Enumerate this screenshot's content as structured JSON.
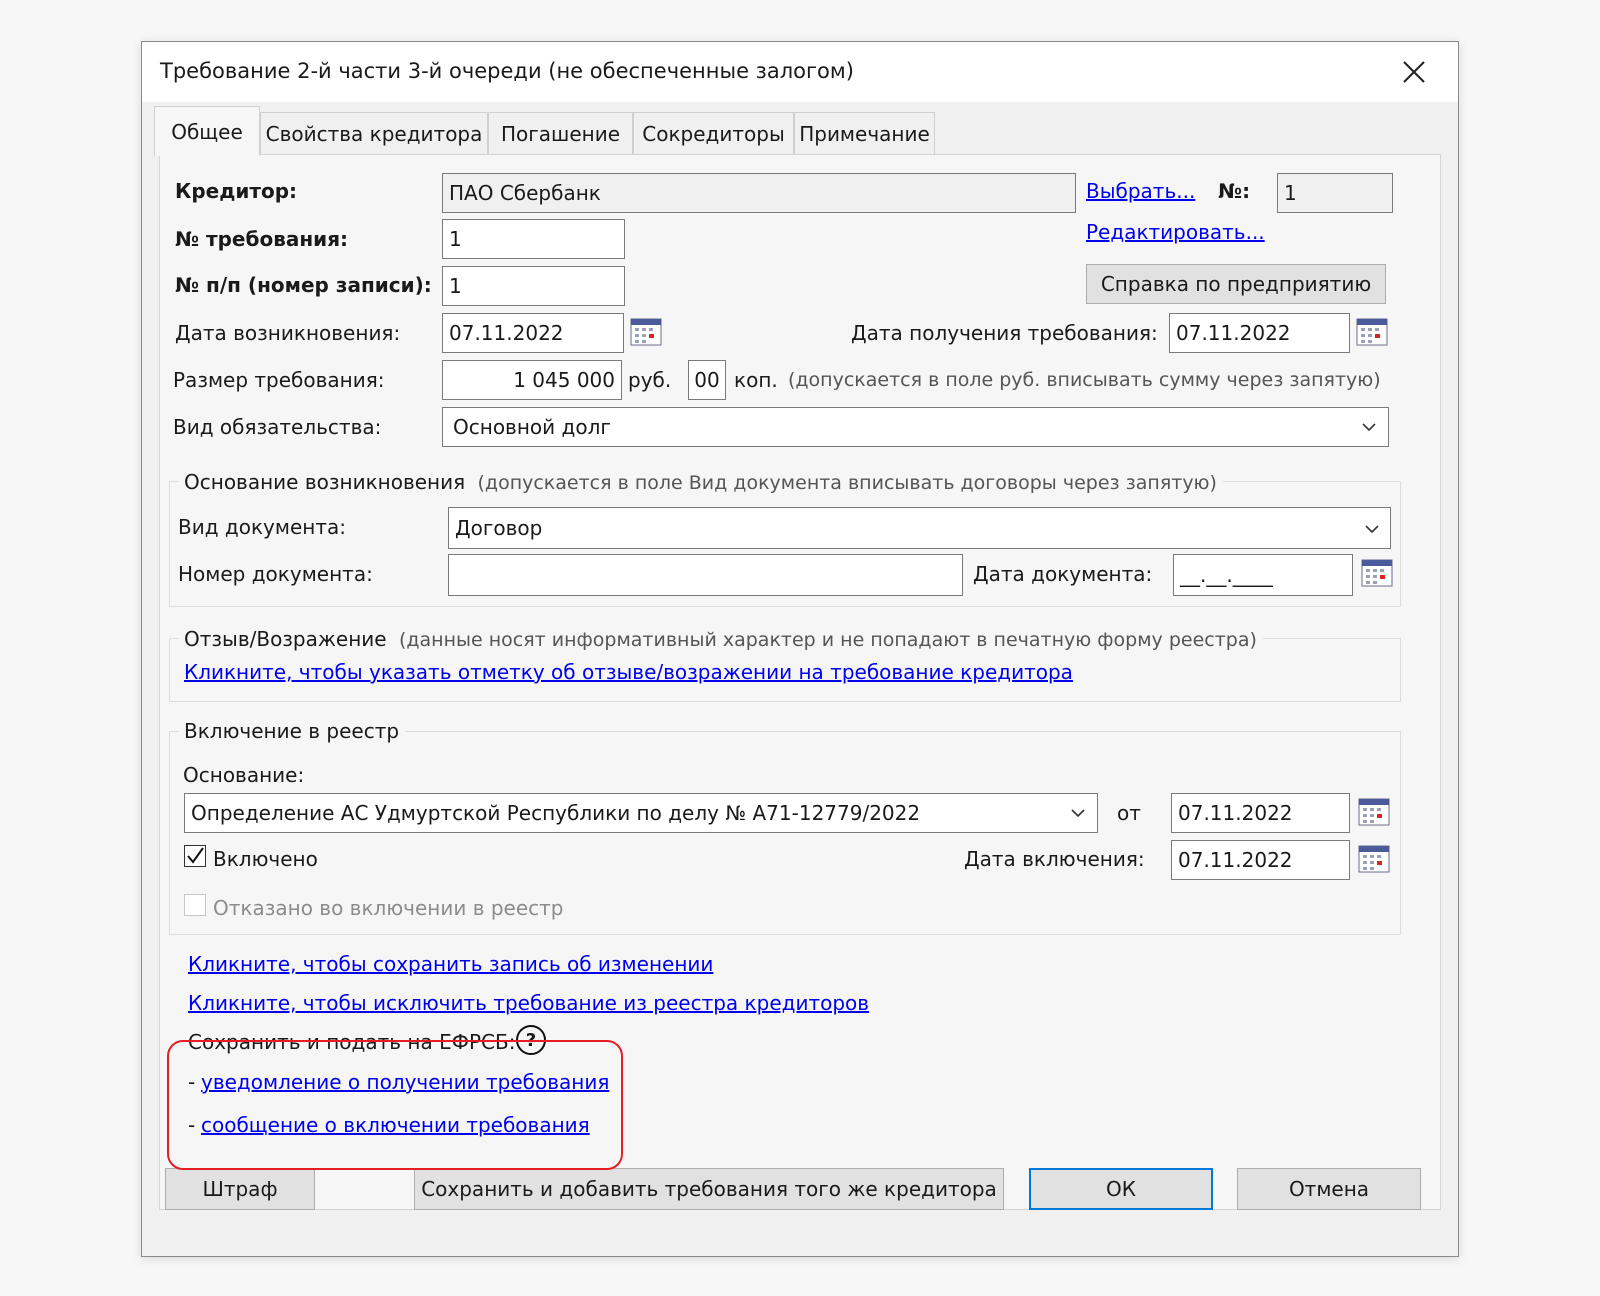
{
  "dialog": {
    "title": "Требование 2-й части 3-й очереди (не обеспеченные залогом)"
  },
  "tabs": [
    {
      "label": "Общее",
      "active": true
    },
    {
      "label": "Свойства кредитора",
      "active": false
    },
    {
      "label": "Погашение",
      "active": false
    },
    {
      "label": "Сокредиторы",
      "active": false
    },
    {
      "label": "Примечание",
      "active": false
    }
  ],
  "general": {
    "creditor_label": "Кредитор:",
    "creditor_value": "ПАО Сбербанк",
    "choose_link": "Выбрать...",
    "number_label": "№:",
    "number_value": "1",
    "edit_link": "Редактировать...",
    "claim_no_label": "№ требования:",
    "claim_no_value": "1",
    "record_no_label": "№ п/п (номер записи):",
    "record_no_value": "1",
    "company_info_button": "Справка по предприятию",
    "origin_date_label": "Дата возникновения:",
    "origin_date_value": "07.11.2022",
    "receipt_date_label": "Дата получения требования:",
    "receipt_date_value": "07.11.2022",
    "amount_label": "Размер требования:",
    "amount_rub_value": "1 045 000",
    "rub_unit": "руб.",
    "amount_kop_value": "00",
    "kop_unit": "коп.",
    "amount_hint": "(допускается в поле руб. вписывать сумму через запятую)",
    "obligation_label": "Вид обязательства:",
    "obligation_value": "Основной долг"
  },
  "basis": {
    "title": "Основание возникновения",
    "hint": "(допускается в поле Вид документа вписывать договоры через запятую)",
    "doc_type_label": "Вид документа:",
    "doc_type_value": "Договор",
    "doc_number_label": "Номер документа:",
    "doc_number_value": "",
    "doc_date_label": "Дата документа:",
    "doc_date_value": "__.__.____"
  },
  "objection": {
    "title": "Отзыв/Возражение",
    "hint": "(данные носят информативный характер и не попадают в печатную форму реестра)",
    "link": "Кликните, чтобы указать отметку об отзыве/возражении на требование кредитора"
  },
  "registry": {
    "title": "Включение в реестр",
    "basis_label": "Основание:",
    "basis_value": "Определение АС Удмуртской Республики по делу № А71-12779/2022",
    "from_label": "от",
    "from_date_value": "07.11.2022",
    "included_label": "Включено",
    "included_checked": true,
    "inclusion_date_label": "Дата включения:",
    "inclusion_date_value": "07.11.2022",
    "refused_label": "Отказано во включении в реестр",
    "refused_checked": false
  },
  "links": {
    "save_change": "Кликните, чтобы сохранить запись об изменении",
    "exclude": "Кликните, чтобы исключить требование из реестра кредиторов"
  },
  "efrsb": {
    "title": "Сохранить и подать на ЕФРСБ:",
    "help_icon_text": "?",
    "dash1": "-",
    "notice_link": "уведомление о получении требования",
    "dash2": "-",
    "message_link": "сообщение о включении требования"
  },
  "footer": {
    "fine_button": "Штраф",
    "save_add_button": "Сохранить и добавить требования того же кредитора",
    "ok_button": "ОК",
    "cancel_button": "Отмена"
  },
  "colors": {
    "link": "#0000ee",
    "highlight": "#e31e24",
    "default_button_border": "#0078d7"
  }
}
